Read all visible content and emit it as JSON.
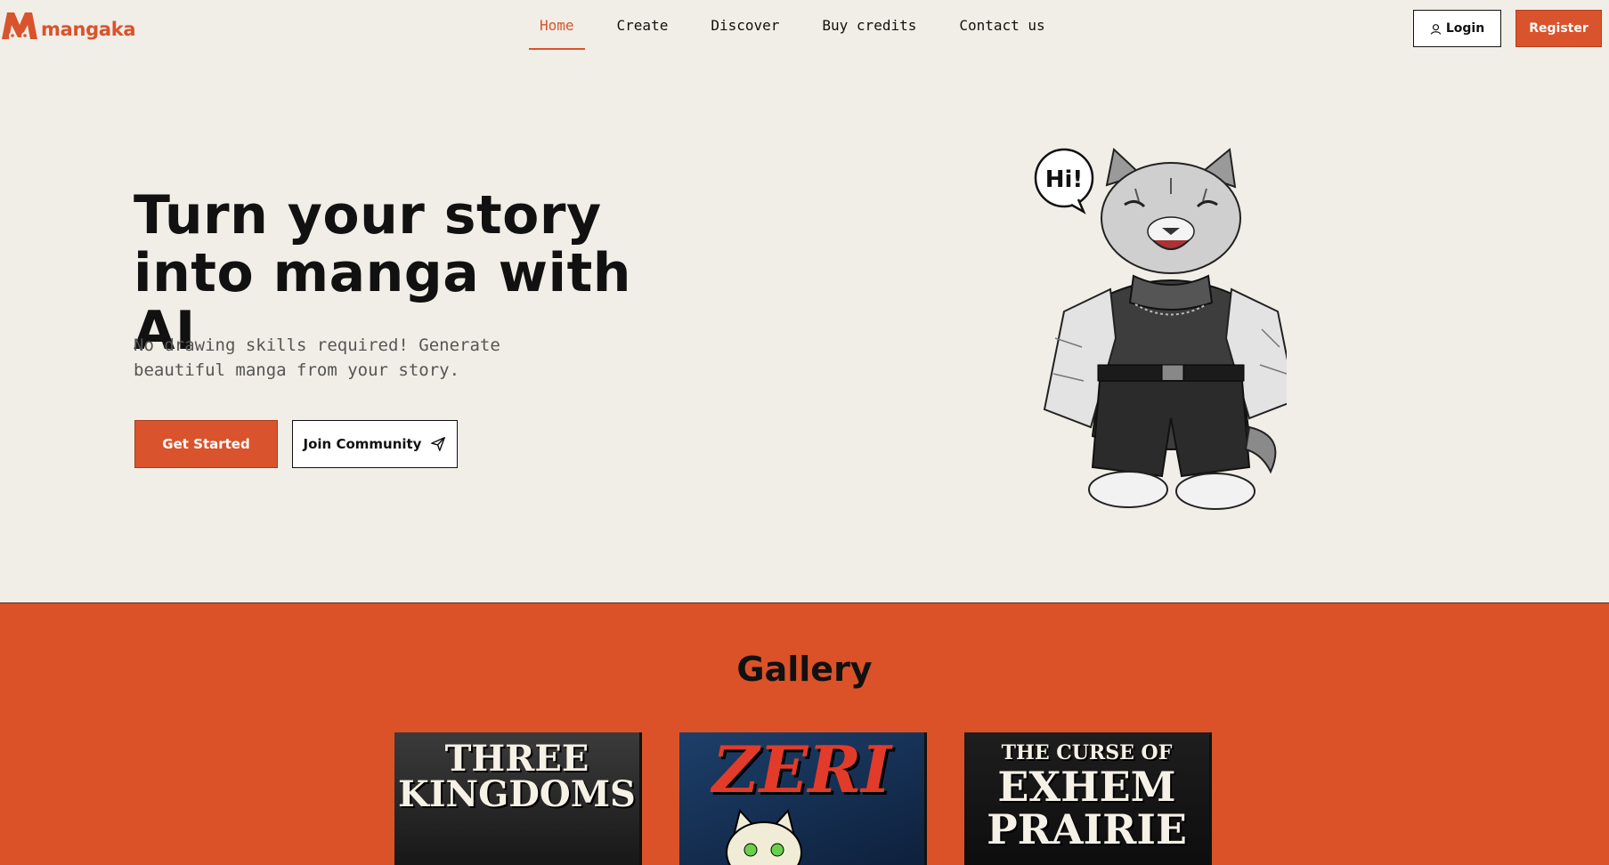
{
  "brand": {
    "name": "mangaka",
    "color": "#d9532c"
  },
  "nav": {
    "links": [
      {
        "label": "Home",
        "active": true
      },
      {
        "label": "Create",
        "active": false
      },
      {
        "label": "Discover",
        "active": false
      },
      {
        "label": "Buy credits",
        "active": false
      },
      {
        "label": "Contact us",
        "active": false
      }
    ],
    "login_label": "Login",
    "register_label": "Register"
  },
  "hero": {
    "title_line1": "Turn your story",
    "title_line2": "into manga with AI",
    "subtitle": "No drawing skills required! Generate beautiful manga from your story.",
    "get_started_label": "Get Started",
    "join_community_label": "Join Community",
    "speech_bubble": "Hi!"
  },
  "gallery": {
    "title": "Gallery",
    "covers": [
      {
        "title_lines": [
          "THREE",
          "KINGDOMS"
        ]
      },
      {
        "title_lines": [
          "ZERI"
        ]
      },
      {
        "title_lines": [
          "THE CURSE OF",
          "EXHEM",
          "PRAIRIE"
        ]
      }
    ]
  },
  "colors": {
    "accent": "#d9532c",
    "background": "#f0eee6",
    "gallery_bg": "#db5229"
  }
}
